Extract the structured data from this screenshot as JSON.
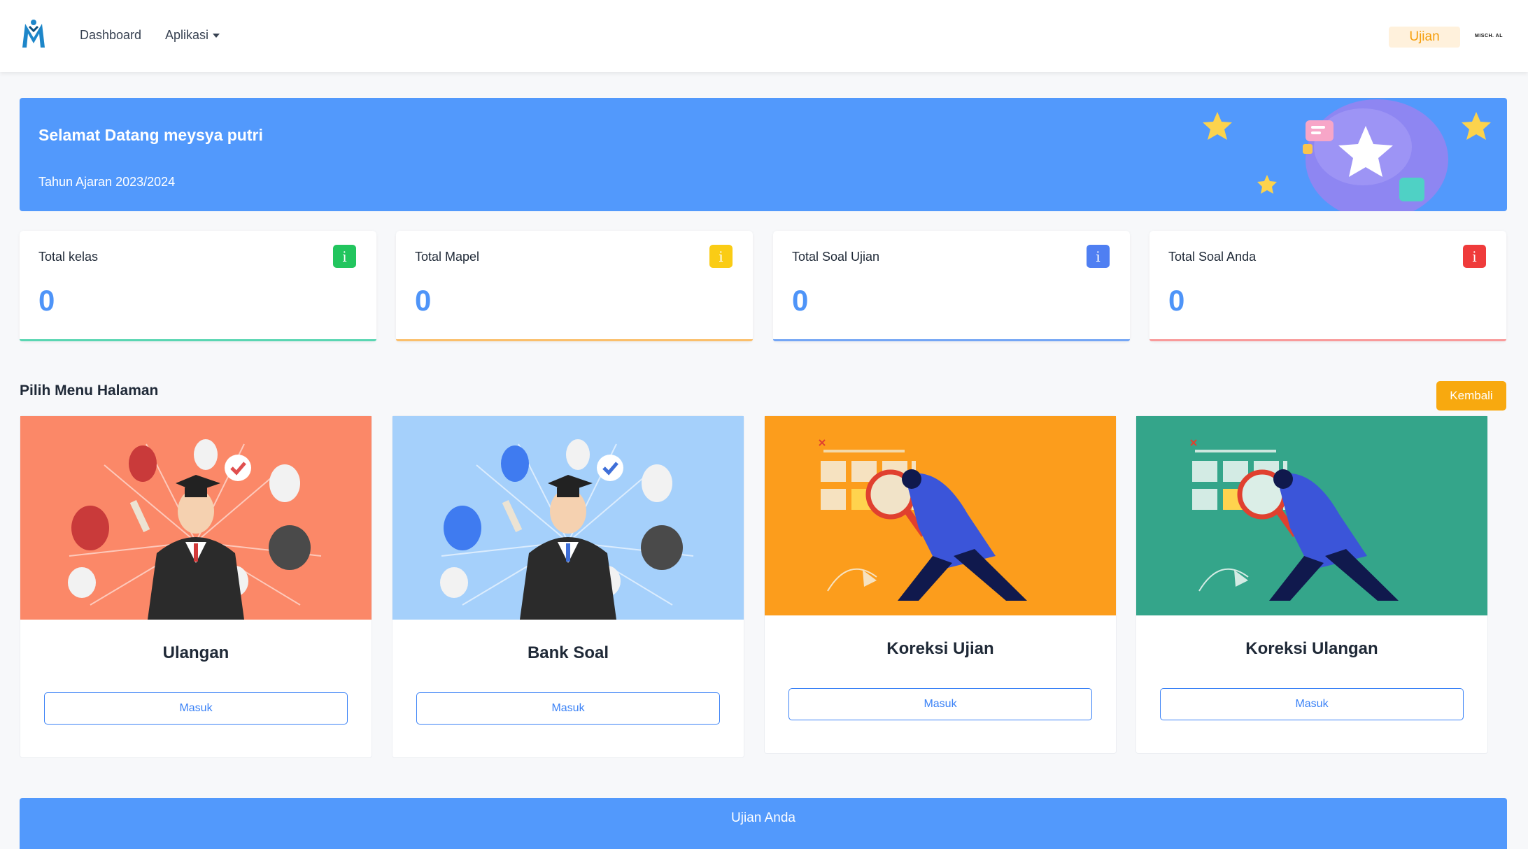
{
  "nav": {
    "dashboard": "Dashboard",
    "aplikasi": "Aplikasi",
    "ujian_badge": "Ujian",
    "school_logo_text": "MISCH. AL"
  },
  "banner": {
    "title": "Selamat Datang meysya putri",
    "subtitle": "Tahun Ajaran 2023/2024"
  },
  "stats": [
    {
      "label": "Total kelas",
      "value": "0",
      "icon": "info-icon",
      "color": "#22c55e"
    },
    {
      "label": "Total Mapel",
      "value": "0",
      "icon": "info-icon",
      "color": "#facc15"
    },
    {
      "label": "Total Soal Ujian",
      "value": "0",
      "icon": "info-icon",
      "color": "#4f7ff2"
    },
    {
      "label": "Total Soal Anda",
      "value": "0",
      "icon": "info-icon",
      "color": "#ef3b3b"
    }
  ],
  "section": {
    "title": "Pilih Menu Halaman",
    "back_label": "Kembali"
  },
  "menu": [
    {
      "title": "Ulangan",
      "button": "Masuk",
      "bg": "#fb8868"
    },
    {
      "title": "Bank Soal",
      "button": "Masuk",
      "bg": "#a5d0fb"
    },
    {
      "title": "Koreksi Ujian",
      "button": "Masuk",
      "bg": "#fc9d1c"
    },
    {
      "title": "Koreksi Ulangan",
      "button": "Masuk",
      "bg": "#34a58a"
    }
  ],
  "bottom": {
    "title": "Ujian Anda"
  }
}
